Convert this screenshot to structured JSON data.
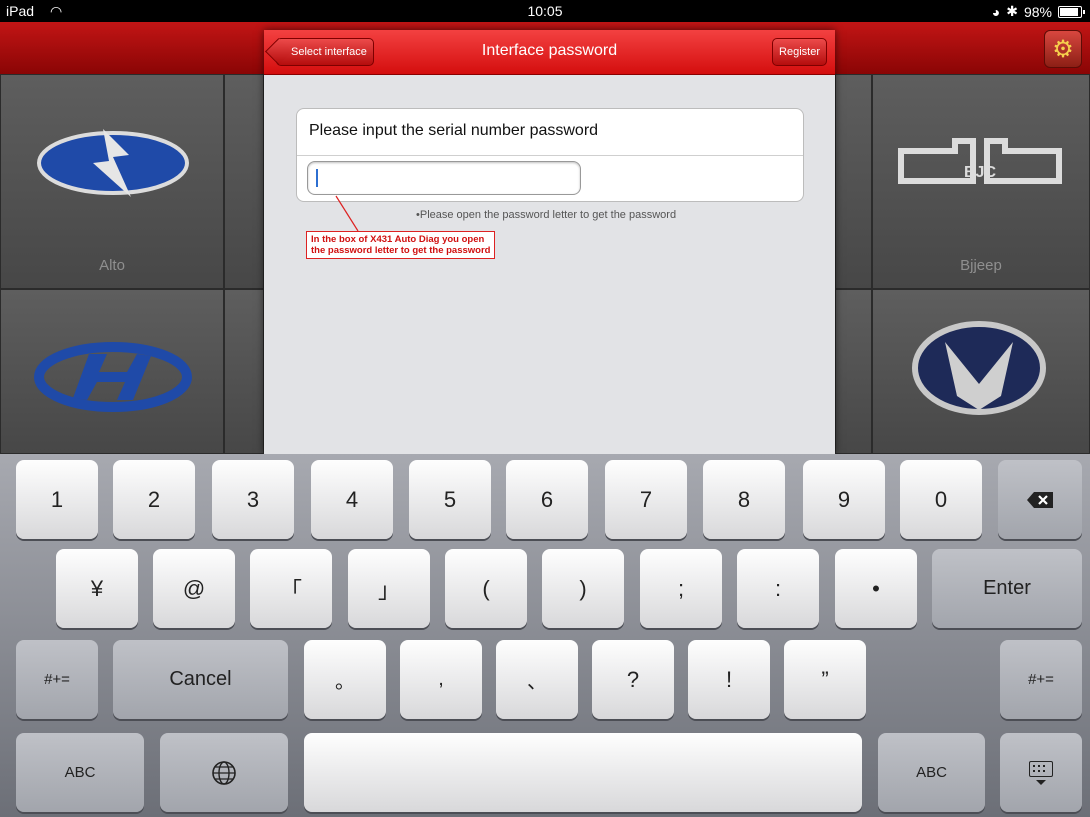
{
  "status": {
    "device": "iPad",
    "time": "10:05",
    "battery": "98%"
  },
  "brands": [
    {
      "name": "Alto"
    },
    {
      "name": "Bjjeep"
    }
  ],
  "modal": {
    "back_label": "Select interface",
    "title": "Interface password",
    "register_label": "Register",
    "prompt": "Please input the serial number password",
    "input_value": "",
    "hint": "•Please open the password letter to get the password",
    "callout_line1": "In the box of X431 Auto Diag you open",
    "callout_line2": "the password letter to get the password"
  },
  "keyboard": {
    "row1": [
      "1",
      "2",
      "3",
      "4",
      "5",
      "6",
      "7",
      "8",
      "9",
      "0"
    ],
    "row2": [
      "¥",
      "@",
      "「",
      "」",
      "(",
      ")",
      ";",
      ":",
      "•"
    ],
    "row3": [
      "。",
      ",",
      "、",
      "?",
      "!",
      "”"
    ],
    "enter": "Enter",
    "symbols": "#+=",
    "cancel": "Cancel",
    "abc": "ABC"
  },
  "colors": {
    "header_red": "#c21515",
    "modal_header_red": "#e82020",
    "callout_red": "#d01010"
  }
}
